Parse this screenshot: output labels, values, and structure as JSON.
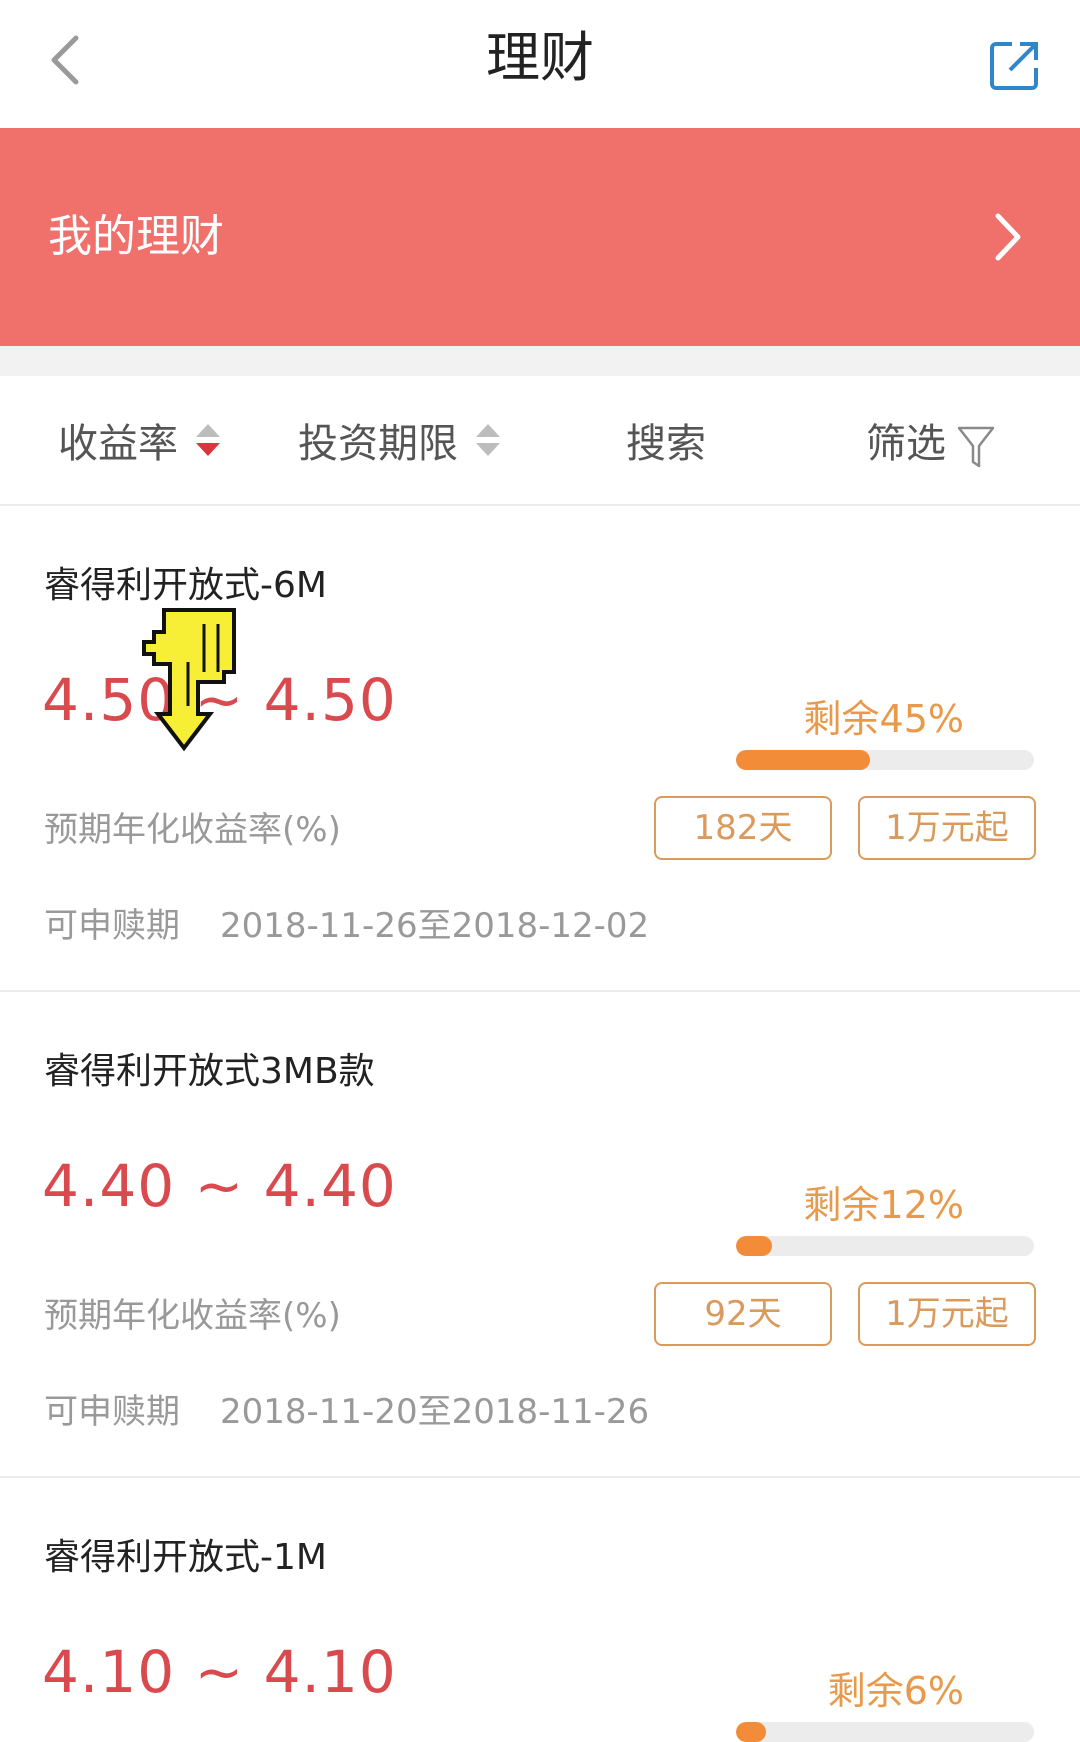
{
  "header": {
    "title": "理财"
  },
  "banner": {
    "label": "我的理财"
  },
  "filters": [
    {
      "label": "收益率"
    },
    {
      "label": "投资期限"
    },
    {
      "label": "搜索"
    },
    {
      "label": "筛选"
    }
  ],
  "products": [
    {
      "name": "睿得利开放式-6M",
      "rate": "4.50 ~ 4.50",
      "rate_label": "预期年化收益率(%)",
      "remaining_label": "剩余45%",
      "remaining_fraction": 0.45,
      "term": "182天",
      "min_invest": "1万元起",
      "redeem_label": "可申赎期",
      "redeem_period": "2018-11-26至2018-12-02"
    },
    {
      "name": "睿得利开放式3MB款",
      "rate": "4.40 ~ 4.40",
      "rate_label": "预期年化收益率(%)",
      "remaining_label": "剩余12%",
      "remaining_fraction": 0.12,
      "term": "92天",
      "min_invest": "1万元起",
      "redeem_label": "可申赎期",
      "redeem_period": "2018-11-20至2018-11-26"
    },
    {
      "name": "睿得利开放式-1M",
      "rate": "4.10 ~ 4.10",
      "remaining_label": "剩余6%",
      "remaining_fraction": 0.06
    }
  ],
  "colors": {
    "banner": "#f0706b",
    "rate": "#d94a4f",
    "remaining": "#e89a4a",
    "progress": "#f28c38",
    "tag": "#d99a5c",
    "share_icon": "#2f86c9"
  },
  "icons": {
    "back": "chevron-left-icon",
    "share": "share-external-icon",
    "banner": "chevron-right-icon",
    "filter": "funnel-icon",
    "cursor": "pointing-hand-cursor-icon"
  }
}
